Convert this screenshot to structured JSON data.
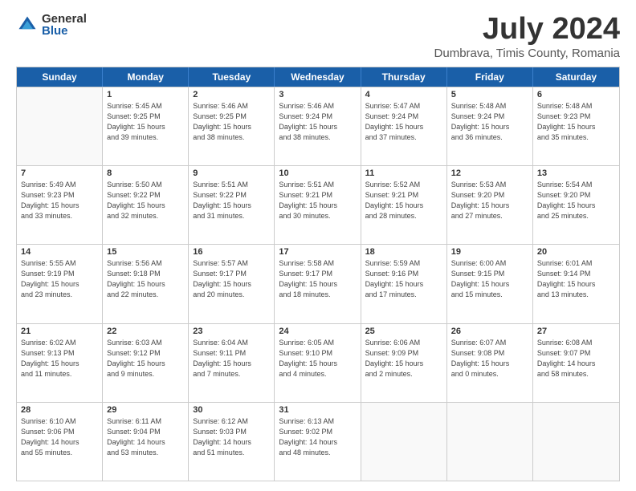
{
  "logo": {
    "general": "General",
    "blue": "Blue"
  },
  "title": "July 2024",
  "location": "Dumbrava, Timis County, Romania",
  "headers": [
    "Sunday",
    "Monday",
    "Tuesday",
    "Wednesday",
    "Thursday",
    "Friday",
    "Saturday"
  ],
  "rows": [
    [
      {
        "day": "",
        "info": ""
      },
      {
        "day": "1",
        "info": "Sunrise: 5:45 AM\nSunset: 9:25 PM\nDaylight: 15 hours\nand 39 minutes."
      },
      {
        "day": "2",
        "info": "Sunrise: 5:46 AM\nSunset: 9:25 PM\nDaylight: 15 hours\nand 38 minutes."
      },
      {
        "day": "3",
        "info": "Sunrise: 5:46 AM\nSunset: 9:24 PM\nDaylight: 15 hours\nand 38 minutes."
      },
      {
        "day": "4",
        "info": "Sunrise: 5:47 AM\nSunset: 9:24 PM\nDaylight: 15 hours\nand 37 minutes."
      },
      {
        "day": "5",
        "info": "Sunrise: 5:48 AM\nSunset: 9:24 PM\nDaylight: 15 hours\nand 36 minutes."
      },
      {
        "day": "6",
        "info": "Sunrise: 5:48 AM\nSunset: 9:23 PM\nDaylight: 15 hours\nand 35 minutes."
      }
    ],
    [
      {
        "day": "7",
        "info": "Sunrise: 5:49 AM\nSunset: 9:23 PM\nDaylight: 15 hours\nand 33 minutes."
      },
      {
        "day": "8",
        "info": "Sunrise: 5:50 AM\nSunset: 9:22 PM\nDaylight: 15 hours\nand 32 minutes."
      },
      {
        "day": "9",
        "info": "Sunrise: 5:51 AM\nSunset: 9:22 PM\nDaylight: 15 hours\nand 31 minutes."
      },
      {
        "day": "10",
        "info": "Sunrise: 5:51 AM\nSunset: 9:21 PM\nDaylight: 15 hours\nand 30 minutes."
      },
      {
        "day": "11",
        "info": "Sunrise: 5:52 AM\nSunset: 9:21 PM\nDaylight: 15 hours\nand 28 minutes."
      },
      {
        "day": "12",
        "info": "Sunrise: 5:53 AM\nSunset: 9:20 PM\nDaylight: 15 hours\nand 27 minutes."
      },
      {
        "day": "13",
        "info": "Sunrise: 5:54 AM\nSunset: 9:20 PM\nDaylight: 15 hours\nand 25 minutes."
      }
    ],
    [
      {
        "day": "14",
        "info": "Sunrise: 5:55 AM\nSunset: 9:19 PM\nDaylight: 15 hours\nand 23 minutes."
      },
      {
        "day": "15",
        "info": "Sunrise: 5:56 AM\nSunset: 9:18 PM\nDaylight: 15 hours\nand 22 minutes."
      },
      {
        "day": "16",
        "info": "Sunrise: 5:57 AM\nSunset: 9:17 PM\nDaylight: 15 hours\nand 20 minutes."
      },
      {
        "day": "17",
        "info": "Sunrise: 5:58 AM\nSunset: 9:17 PM\nDaylight: 15 hours\nand 18 minutes."
      },
      {
        "day": "18",
        "info": "Sunrise: 5:59 AM\nSunset: 9:16 PM\nDaylight: 15 hours\nand 17 minutes."
      },
      {
        "day": "19",
        "info": "Sunrise: 6:00 AM\nSunset: 9:15 PM\nDaylight: 15 hours\nand 15 minutes."
      },
      {
        "day": "20",
        "info": "Sunrise: 6:01 AM\nSunset: 9:14 PM\nDaylight: 15 hours\nand 13 minutes."
      }
    ],
    [
      {
        "day": "21",
        "info": "Sunrise: 6:02 AM\nSunset: 9:13 PM\nDaylight: 15 hours\nand 11 minutes."
      },
      {
        "day": "22",
        "info": "Sunrise: 6:03 AM\nSunset: 9:12 PM\nDaylight: 15 hours\nand 9 minutes."
      },
      {
        "day": "23",
        "info": "Sunrise: 6:04 AM\nSunset: 9:11 PM\nDaylight: 15 hours\nand 7 minutes."
      },
      {
        "day": "24",
        "info": "Sunrise: 6:05 AM\nSunset: 9:10 PM\nDaylight: 15 hours\nand 4 minutes."
      },
      {
        "day": "25",
        "info": "Sunrise: 6:06 AM\nSunset: 9:09 PM\nDaylight: 15 hours\nand 2 minutes."
      },
      {
        "day": "26",
        "info": "Sunrise: 6:07 AM\nSunset: 9:08 PM\nDaylight: 15 hours\nand 0 minutes."
      },
      {
        "day": "27",
        "info": "Sunrise: 6:08 AM\nSunset: 9:07 PM\nDaylight: 14 hours\nand 58 minutes."
      }
    ],
    [
      {
        "day": "28",
        "info": "Sunrise: 6:10 AM\nSunset: 9:06 PM\nDaylight: 14 hours\nand 55 minutes."
      },
      {
        "day": "29",
        "info": "Sunrise: 6:11 AM\nSunset: 9:04 PM\nDaylight: 14 hours\nand 53 minutes."
      },
      {
        "day": "30",
        "info": "Sunrise: 6:12 AM\nSunset: 9:03 PM\nDaylight: 14 hours\nand 51 minutes."
      },
      {
        "day": "31",
        "info": "Sunrise: 6:13 AM\nSunset: 9:02 PM\nDaylight: 14 hours\nand 48 minutes."
      },
      {
        "day": "",
        "info": ""
      },
      {
        "day": "",
        "info": ""
      },
      {
        "day": "",
        "info": ""
      }
    ]
  ]
}
